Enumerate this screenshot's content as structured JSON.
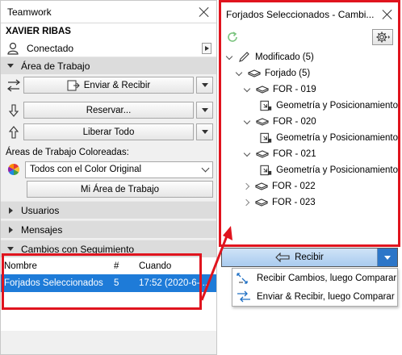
{
  "teamwork": {
    "title": "Teamwork",
    "user": "XAVIER RIBAS",
    "status": "Conectado",
    "sections": {
      "workspace": "Área de Trabajo",
      "users": "Usuarios",
      "messages": "Mensajes",
      "tracked_changes": "Cambios con Seguimiento"
    },
    "buttons": {
      "send_receive": "Enviar & Recibir",
      "reserve": "Reservar...",
      "release_all": "Liberar Todo",
      "my_workspace": "Mi Área de Trabajo"
    },
    "colored_label": "Áreas de Trabajo Coloreadas:",
    "colored_selected": "Todos con el Color Original",
    "table": {
      "headers": [
        "Nombre",
        "#",
        "Cuando"
      ],
      "rows": [
        {
          "name": "Forjados Seleccionados",
          "count": "5",
          "when": "17:52 (2020-6-..."
        }
      ]
    }
  },
  "floating": {
    "title": "Forjados Seleccionados - Cambi...",
    "tree": {
      "root": "Modificado (5)",
      "group": "Forjado (5)",
      "items": [
        {
          "label": "FOR - 019",
          "child": "Geometría y Posicionamiento"
        },
        {
          "label": "FOR - 020",
          "child": "Geometría y Posicionamiento"
        },
        {
          "label": "FOR - 021",
          "child": "Geometría y Posicionamiento"
        },
        {
          "label": "FOR - 022"
        },
        {
          "label": "FOR - 023"
        }
      ]
    },
    "receive_label": "Recibir",
    "menu": [
      "Recibir Cambios, luego Comparar",
      "Enviar & Recibir, luego Comparar"
    ]
  },
  "colors": {
    "highlight_red": "#e0141e",
    "selection_blue": "#1e7bd8",
    "receive_blue": "#2d76c8"
  }
}
